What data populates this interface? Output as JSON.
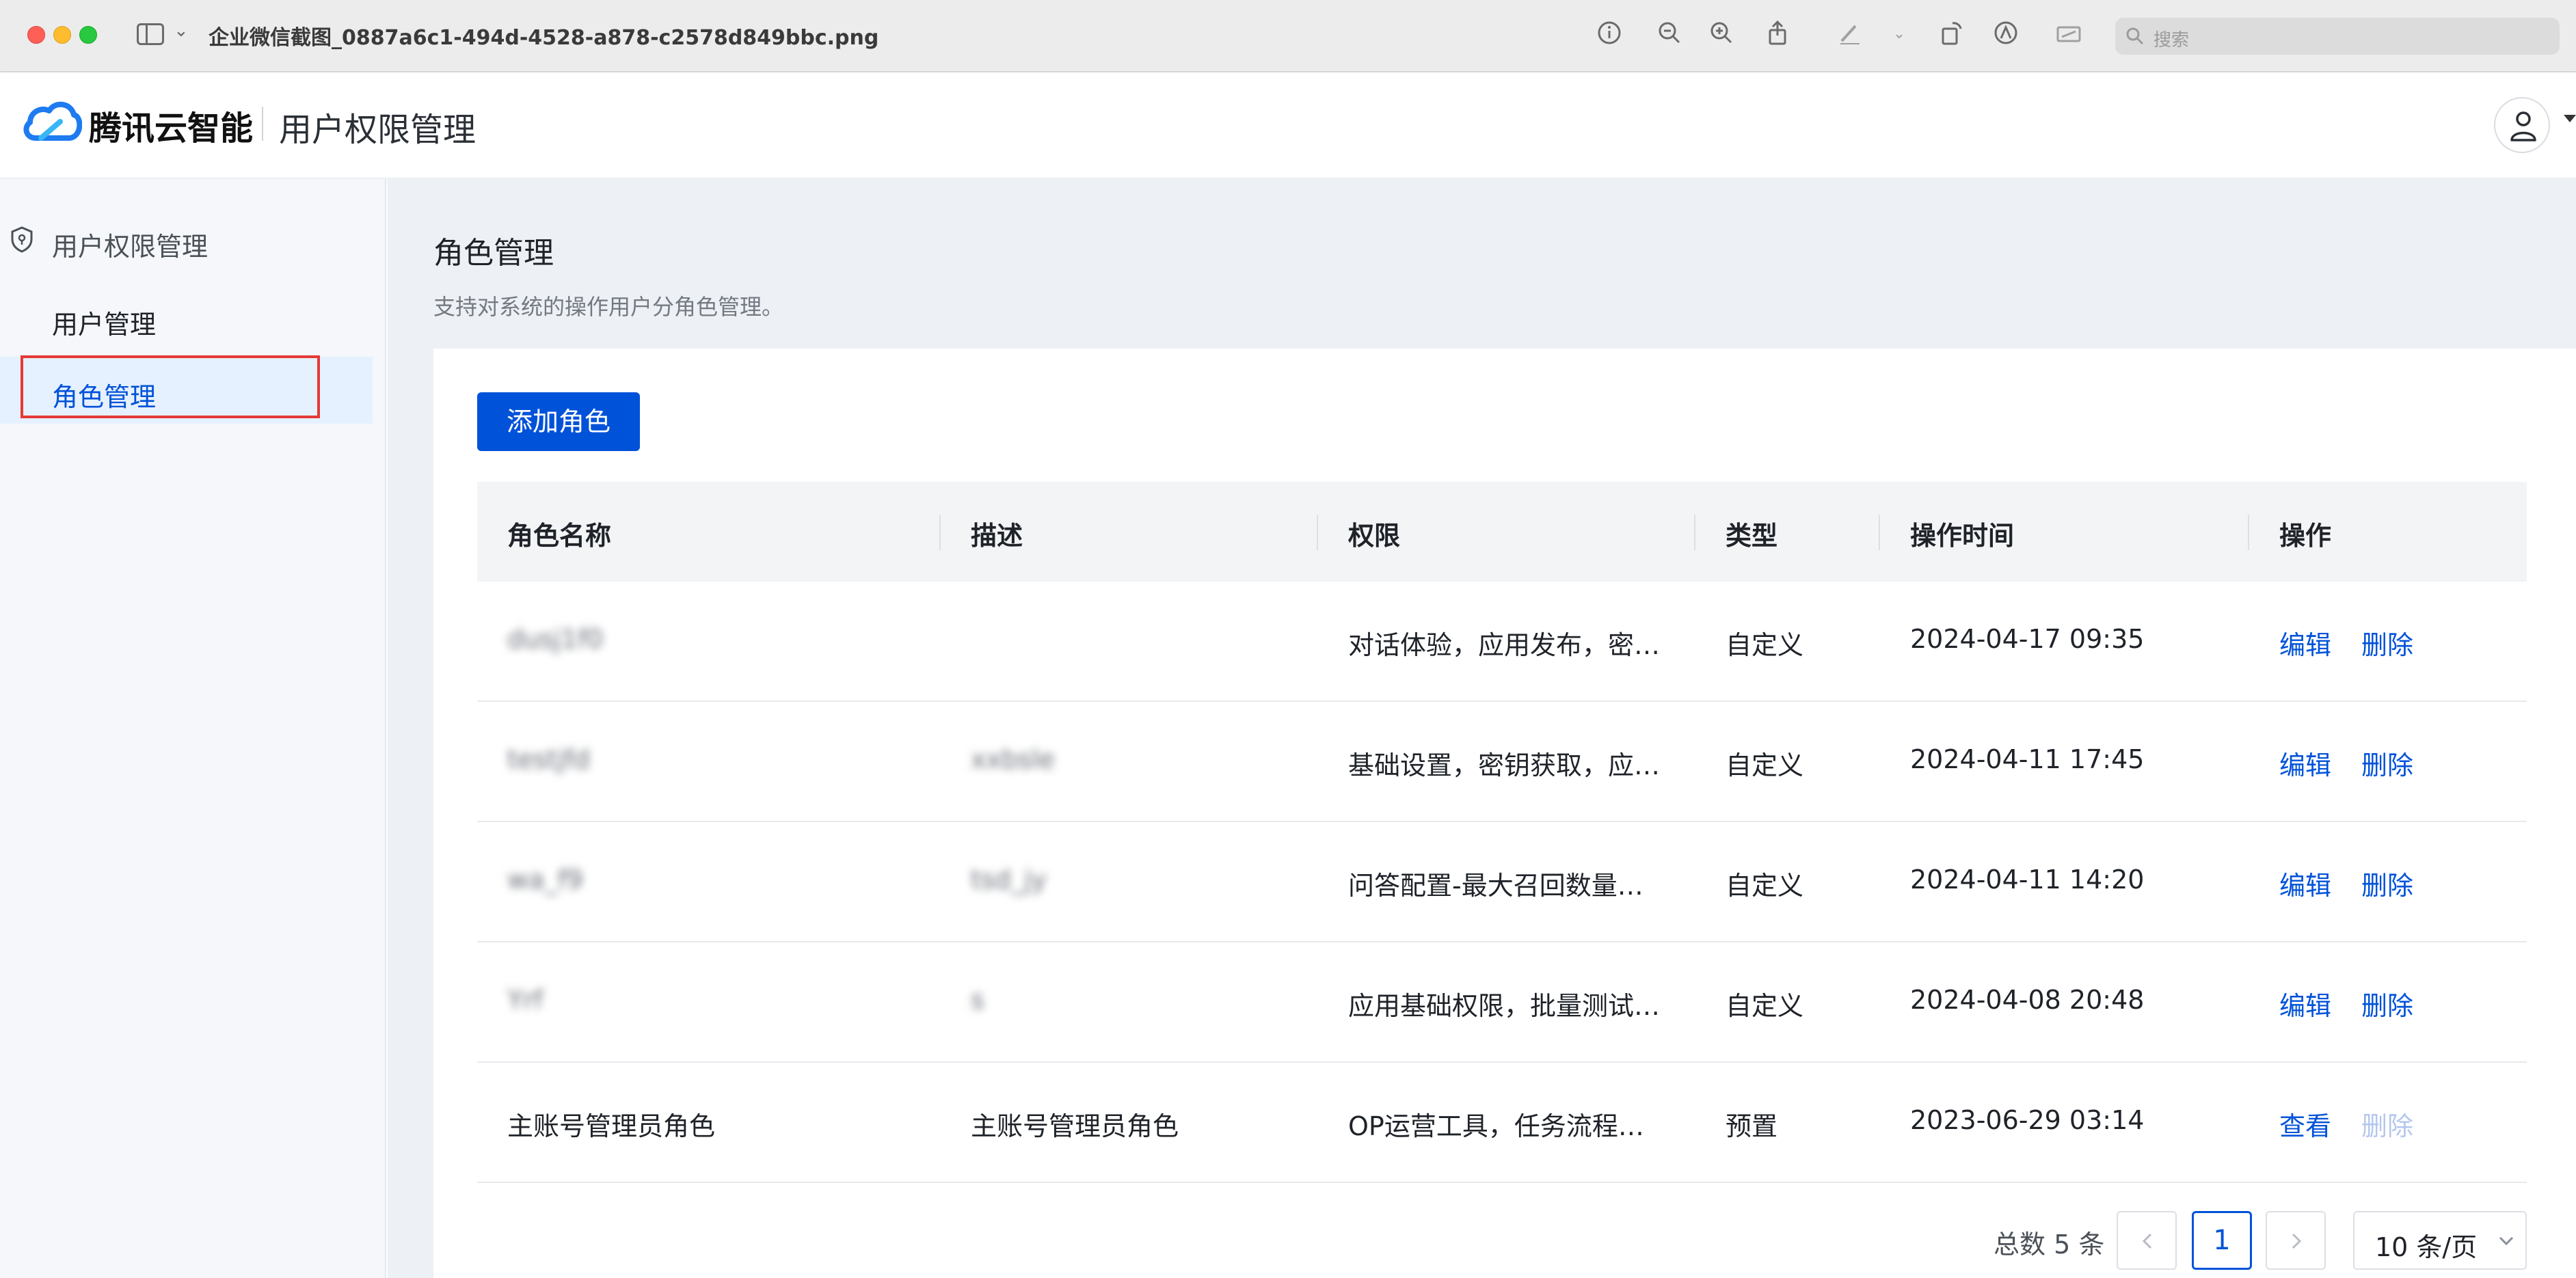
{
  "window": {
    "filename": "企业微信截图_0887a6c1-494d-4528-a878-c2578d849bbc.png",
    "search_placeholder": "搜索"
  },
  "header": {
    "logo_text": "腾讯云智能",
    "title": "用户权限管理"
  },
  "sidebar": {
    "group_label": "用户权限管理",
    "items": [
      {
        "label": "用户管理",
        "active": false
      },
      {
        "label": "角色管理",
        "active": true
      }
    ]
  },
  "page": {
    "title": "角色管理",
    "subtitle": "支持对系统的操作用户分角色管理。",
    "add_button": "添加角色"
  },
  "table": {
    "columns": [
      "角色名称",
      "描述",
      "权限",
      "类型",
      "操作时间",
      "操作"
    ],
    "rows": [
      {
        "name": "dusj1f0",
        "description": "",
        "permissions": "对话体验，应用发布，密…",
        "type": "自定义",
        "time": "2024-04-17 09:35",
        "action1": "编辑",
        "action2": "删除",
        "action2_disabled": false
      },
      {
        "name": "testjfd",
        "description": "xxbsle",
        "permissions": "基础设置，密钥获取，应…",
        "type": "自定义",
        "time": "2024-04-11 17:45",
        "action1": "编辑",
        "action2": "删除",
        "action2_disabled": false
      },
      {
        "name": "wa_f9",
        "description": "tsd_jy",
        "permissions": "问答配置-最大召回数量…",
        "type": "自定义",
        "time": "2024-04-11 14:20",
        "action1": "编辑",
        "action2": "删除",
        "action2_disabled": false
      },
      {
        "name": "Yrf",
        "description": "s",
        "permissions": "应用基础权限，批量测试…",
        "type": "自定义",
        "time": "2024-04-08 20:48",
        "action1": "编辑",
        "action2": "删除",
        "action2_disabled": false
      },
      {
        "name": "主账号管理员角色",
        "description": "主账号管理员角色",
        "permissions": "OP运营工具，任务流程…",
        "type": "预置",
        "time": "2023-06-29 03:14",
        "action1": "查看",
        "action2": "删除",
        "action2_disabled": true
      }
    ]
  },
  "pagination": {
    "total_text": "总数 5 条",
    "current_page": "1",
    "page_size": "10 条/页"
  },
  "colors": {
    "primary": "#0052d9",
    "highlight_box": "#e53935"
  }
}
